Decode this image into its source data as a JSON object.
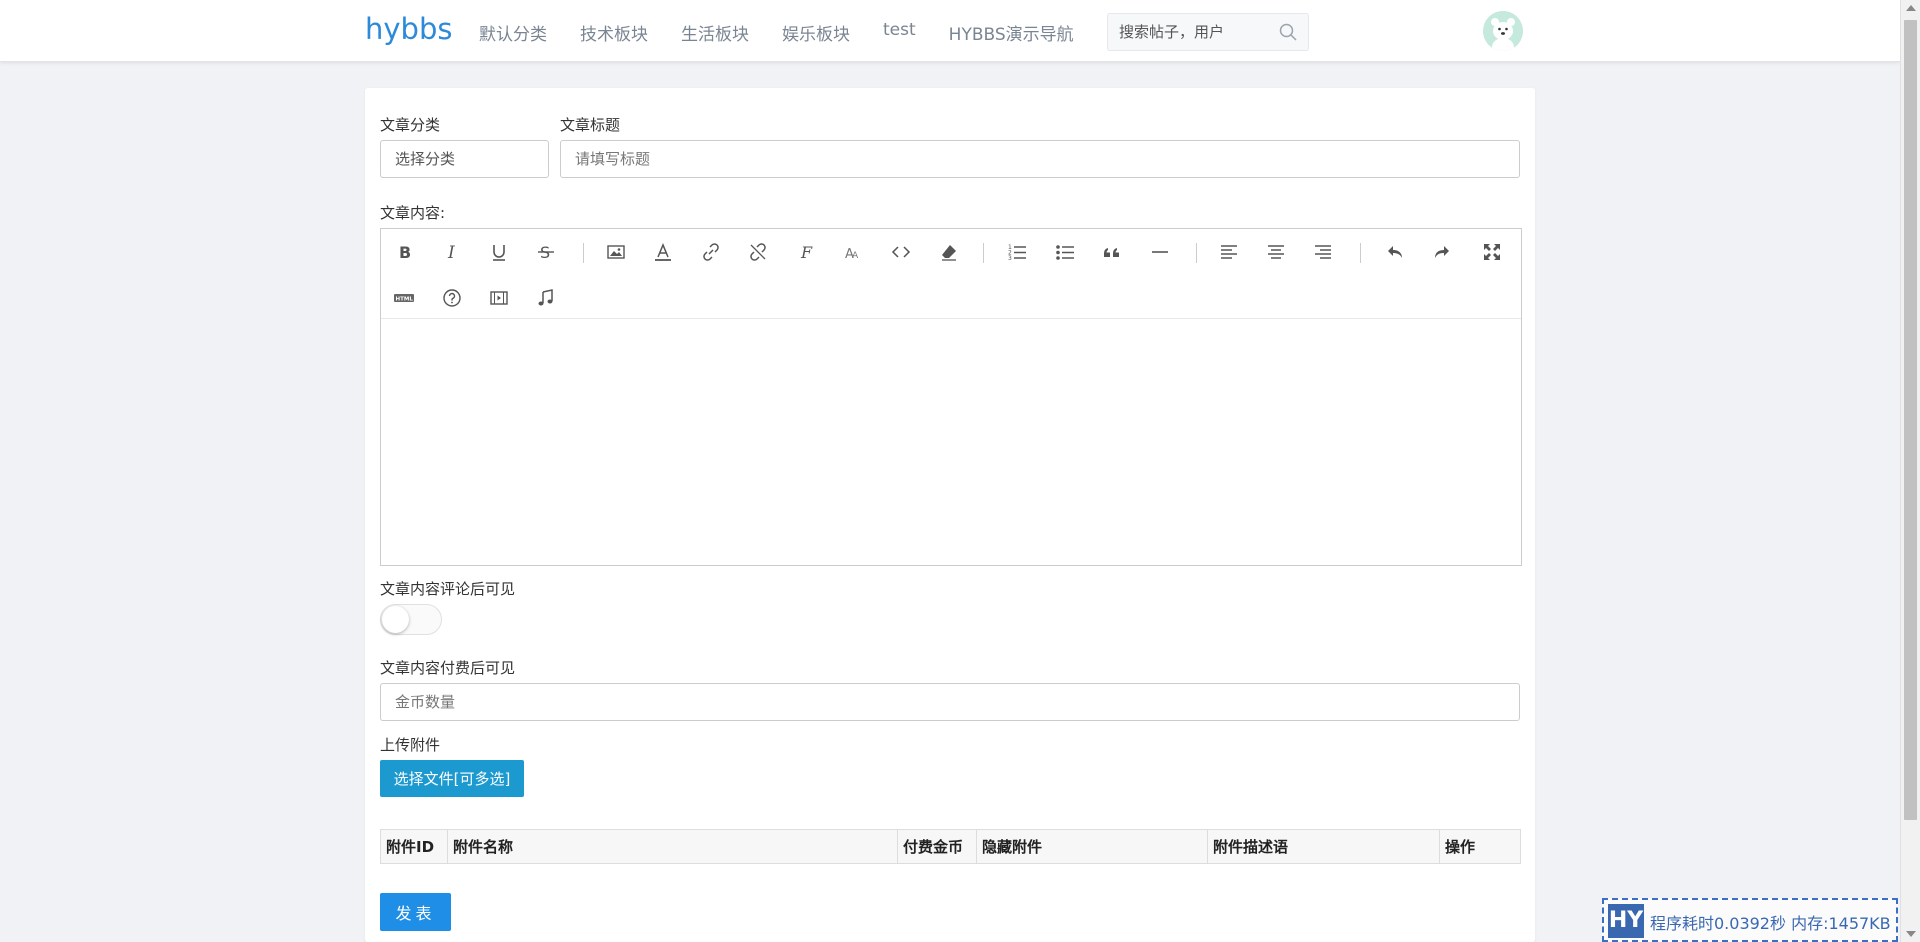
{
  "header": {
    "logo": "hybbs",
    "nav": [
      "默认分类",
      "技术板块",
      "生活板块",
      "娱乐板块",
      "test",
      "HYBBS演示导航"
    ],
    "search_placeholder": "搜索帖子，用户"
  },
  "form": {
    "category_label": "文章分类",
    "category_value": "选择分类",
    "title_label": "文章标题",
    "title_placeholder": "请填写标题",
    "content_label": "文章内容:",
    "comment_visible_label": "文章内容评论后可见",
    "comment_visible_on": false,
    "pay_visible_label": "文章内容付费后可见",
    "coin_placeholder": "金币数量",
    "upload_label": "上传附件",
    "upload_button": "选择文件[可多选]",
    "attachments_columns": [
      "附件ID",
      "附件名称",
      "付费金币",
      "隐藏附件",
      "附件描述语",
      "操作"
    ],
    "publish_button": "发表"
  },
  "toolbar_icons": [
    "bold-icon",
    "italic-icon",
    "underline-icon",
    "strikethrough-icon",
    "image-icon",
    "font-color-icon",
    "link-icon",
    "unlink-icon",
    "font-family-icon",
    "font-size-icon",
    "code-icon",
    "eraser-icon",
    "ordered-list-icon",
    "unordered-list-icon",
    "quote-icon",
    "horizontal-rule-icon",
    "align-left-icon",
    "align-center-icon",
    "align-right-icon",
    "undo-icon",
    "redo-icon",
    "fullscreen-icon",
    "html-icon",
    "help-icon",
    "video-icon",
    "music-icon"
  ],
  "debug": {
    "badge": "HY",
    "text": "程序耗时0.0392秒 内存:1457KB"
  },
  "colors": {
    "brand": "#2d8ad8",
    "upload_button": "#1c9ad0",
    "publish_button": "#1e8ee6"
  }
}
